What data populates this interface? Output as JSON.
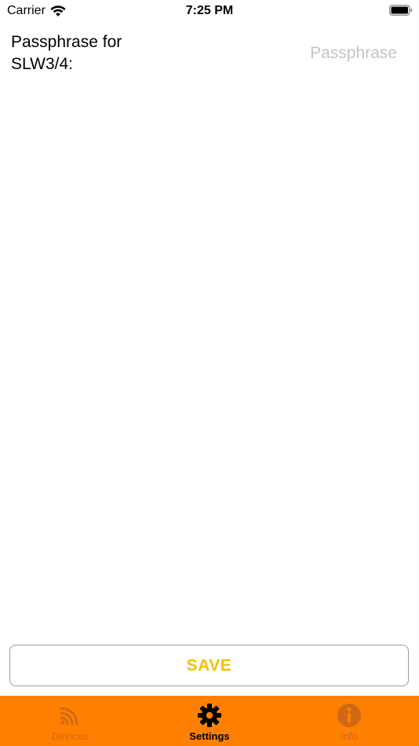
{
  "status_bar": {
    "carrier": "Carrier",
    "time": "7:25 PM"
  },
  "form": {
    "passphrase_label": "Passphrase for SLW3/4:",
    "passphrase_value": "",
    "passphrase_placeholder": "Passphrase"
  },
  "actions": {
    "save_label": "SAVE"
  },
  "tab_bar": {
    "tabs": [
      {
        "label": "Devices",
        "icon": "signal-waves-icon",
        "active": false
      },
      {
        "label": "Settings",
        "icon": "gear-icon",
        "active": true
      },
      {
        "label": "Info",
        "icon": "info-icon",
        "active": false
      }
    ]
  },
  "colors": {
    "tab_bar_background": "#ff8000",
    "save_text": "#f5c000",
    "placeholder": "#c4c4c6",
    "inactive_tab": "#cf6a14"
  }
}
